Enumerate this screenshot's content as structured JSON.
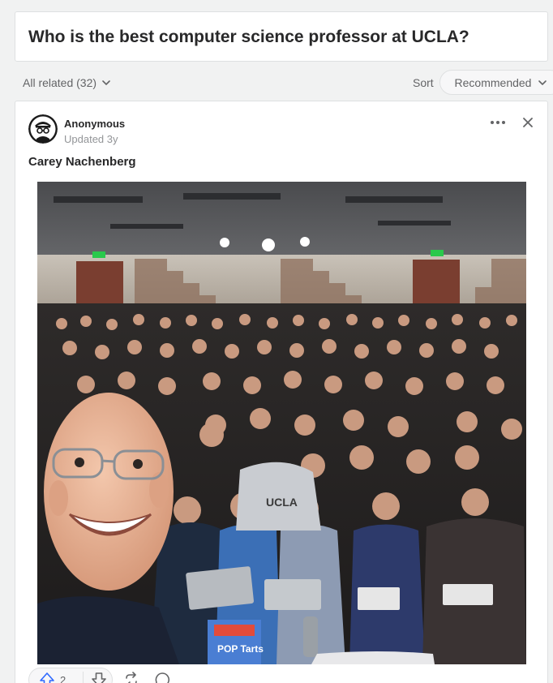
{
  "question": {
    "title": "Who is the best computer science professor at UCLA?"
  },
  "filter_bar": {
    "all_related_label": "All related (32)",
    "sort_label": "Sort",
    "sort_value": "Recommended"
  },
  "answer": {
    "author_name": "Anonymous",
    "updated": "Updated 3y",
    "headline": "Carey Nachenberg",
    "photo": {
      "description_icon": "photo-image",
      "signs": [
        "EXIT",
        "EXIT"
      ],
      "shirt_text": "UCLA",
      "box_text": "POP Tarts"
    }
  },
  "actions": {
    "upvote_count": "2"
  },
  "colors": {
    "background": "#f1f2f2",
    "card": "#ffffff",
    "border": "#dee0e1",
    "upvote_accent": "#2e69ff",
    "text_primary": "#282829",
    "text_secondary": "#636466"
  }
}
